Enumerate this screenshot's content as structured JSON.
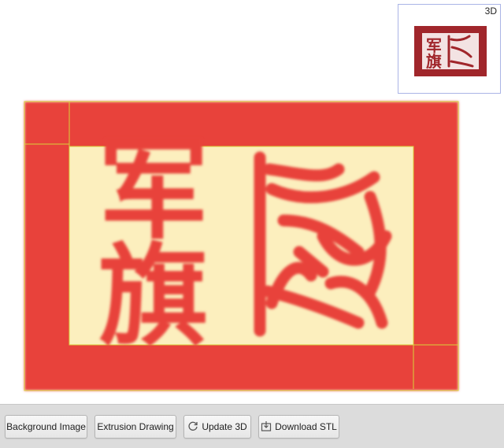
{
  "preview": {
    "label": "3D"
  },
  "seal": {
    "characters": [
      "军",
      "旗"
    ],
    "colors": {
      "red": "#e8423a",
      "cream": "#fcefbe",
      "guide": "#d9d23a",
      "preview_red": "#a0262b"
    }
  },
  "toolbar": {
    "background_image_label": "Background Image",
    "extrusion_drawing_label": "Extrusion Drawing",
    "update_3d_label": "Update 3D",
    "download_stl_label": "Download STL",
    "update_icon": "refresh-icon",
    "download_icon": "download-icon"
  }
}
